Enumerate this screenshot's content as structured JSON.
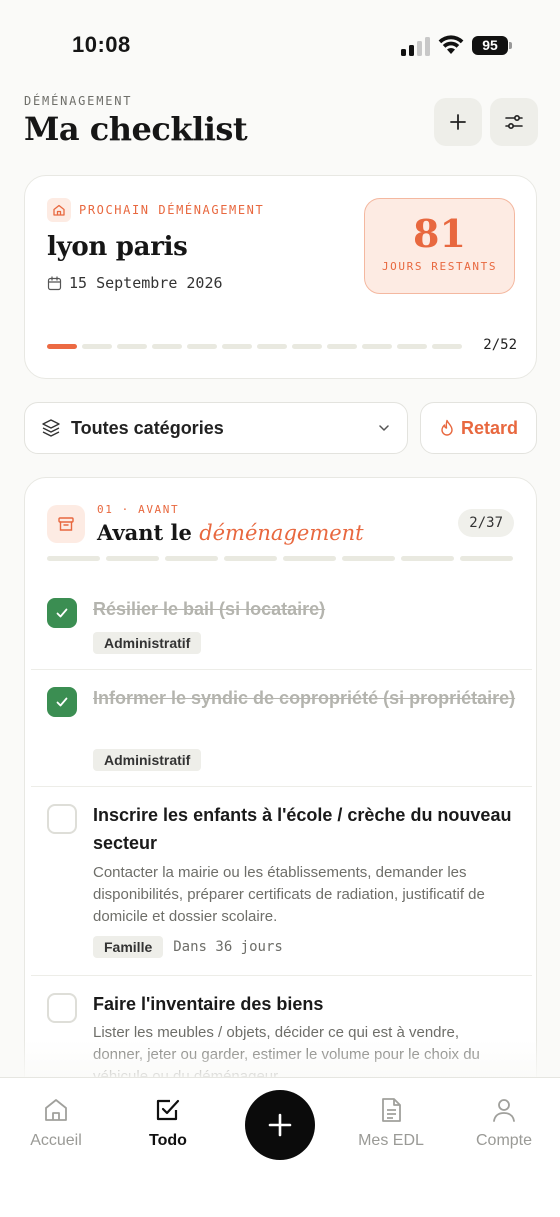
{
  "status_bar": {
    "time": "10:08",
    "battery": "95"
  },
  "header": {
    "eyebrow": "DÉMÉNAGEMENT",
    "title": "Ma checklist"
  },
  "next_move": {
    "badge": "PROCHAIN DÉMÉNAGEMENT",
    "name": "lyon paris",
    "date": "15 Septembre 2026",
    "days_value": "81",
    "days_label": "JOURS RESTANTS",
    "progress_text": "2/52",
    "progress_done": 2,
    "progress_total": 52
  },
  "filters": {
    "category": "Toutes catégories",
    "late_label": "Retard"
  },
  "section": {
    "eyebrow": "01 · AVANT",
    "title_prefix": "Avant le",
    "title_accent": "déménagement",
    "count": "2/37",
    "progress_done": 2,
    "progress_total": 37
  },
  "tasks": [
    {
      "title": "Résilier le bail (si locataire)",
      "done": true,
      "tag": "Administratif"
    },
    {
      "title": "Informer le syndic de copropriété (si propriétaire)",
      "done": true,
      "tag": "Administratif"
    },
    {
      "title": "Inscrire les enfants à l'école / crèche du nouveau secteur",
      "done": false,
      "description": "Contacter la mairie ou les établissements, demander les disponibilités, préparer certificats de radiation, justificatif de domicile et dossier scolaire.",
      "tag": "Famille",
      "due": "Dans 36 jours"
    },
    {
      "title": "Faire l'inventaire des biens",
      "done": false,
      "description": "Lister les meubles / objets, décider ce qui est à vendre, donner, jeter ou garder, estimer le volume pour le choix du véhicule ou du déménageur."
    }
  ],
  "tabbar": {
    "home": "Accueil",
    "todo": "Todo",
    "edl": "Mes EDL",
    "account": "Compte"
  },
  "colors": {
    "accent": "#E8683F",
    "done": "#3B8E52",
    "accent_bg": "#FDEBE3"
  }
}
